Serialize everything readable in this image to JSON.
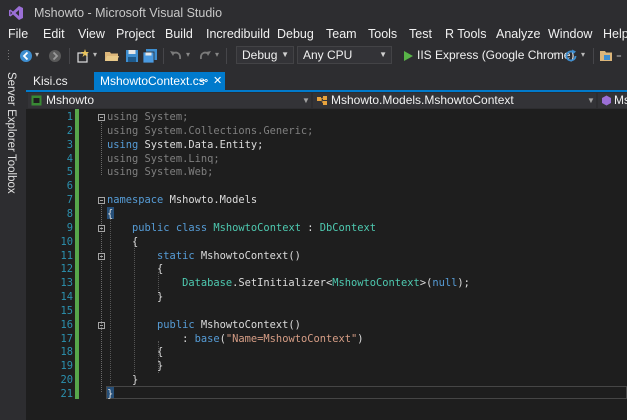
{
  "window": {
    "title": "Mshowto - Microsoft Visual Studio"
  },
  "menu": [
    "File",
    "Edit",
    "View",
    "Project",
    "Build",
    "Incredibuild",
    "Debug",
    "Team",
    "Tools",
    "Test",
    "R Tools",
    "Analyze",
    "Window",
    "Help"
  ],
  "toolbar": {
    "configuration": "Debug",
    "platform": "Any CPU",
    "run_target": "IIS Express (Google Chrome)"
  },
  "side_tabs": [
    "Server Explorer",
    "Toolbox"
  ],
  "tabs": [
    {
      "label": "Kisi.cs",
      "active": false
    },
    {
      "label": "MshowtoContext.cs",
      "active": true
    }
  ],
  "nav": {
    "project": "Mshowto",
    "class": "Mshowto.Models.MshowtoContext",
    "member": "Ms"
  },
  "line_numbers": [
    "1",
    "2",
    "3",
    "4",
    "5",
    "6",
    "7",
    "8",
    "9",
    "10",
    "11",
    "12",
    "13",
    "14",
    "15",
    "16",
    "17",
    "18",
    "19",
    "20",
    "21"
  ],
  "code": [
    [
      [
        "u",
        "using"
      ],
      [
        "u",
        " System;"
      ]
    ],
    [
      [
        "u",
        "using"
      ],
      [
        "u",
        " System.Collections.Generic;"
      ]
    ],
    [
      [
        "k",
        "using"
      ],
      [
        "p",
        " System.Data.Entity;"
      ]
    ],
    [
      [
        "u",
        "using"
      ],
      [
        "u",
        " System.Linq;"
      ]
    ],
    [
      [
        "u",
        "using"
      ],
      [
        "u",
        " System.Web;"
      ]
    ],
    [],
    [
      [
        "k",
        "namespace"
      ],
      [
        "p",
        " Mshowto.Models"
      ]
    ],
    [
      [
        "p",
        "{"
      ]
    ],
    [
      [
        "p",
        "    "
      ],
      [
        "k",
        "public"
      ],
      [
        "p",
        " "
      ],
      [
        "k",
        "class"
      ],
      [
        "p",
        " "
      ],
      [
        "t",
        "MshowtoContext"
      ],
      [
        "p",
        " : "
      ],
      [
        "t",
        "DbContext"
      ]
    ],
    [
      [
        "p",
        "    {"
      ]
    ],
    [
      [
        "p",
        "        "
      ],
      [
        "k",
        "static"
      ],
      [
        "p",
        " MshowtoContext()"
      ]
    ],
    [
      [
        "p",
        "        {"
      ]
    ],
    [
      [
        "p",
        "            "
      ],
      [
        "t",
        "Database"
      ],
      [
        "p",
        ".SetInitializer<"
      ],
      [
        "t",
        "MshowtoContext"
      ],
      [
        "p",
        ">("
      ],
      [
        "k",
        "null"
      ],
      [
        "p",
        ");"
      ]
    ],
    [
      [
        "p",
        "        }"
      ]
    ],
    [],
    [
      [
        "p",
        "        "
      ],
      [
        "k",
        "public"
      ],
      [
        "p",
        " MshowtoContext()"
      ]
    ],
    [
      [
        "p",
        "            : "
      ],
      [
        "k",
        "base"
      ],
      [
        "p",
        "("
      ],
      [
        "s",
        "\"Name=MshowtoContext\""
      ],
      [
        "p",
        ")"
      ]
    ],
    [
      [
        "p",
        "        {"
      ]
    ],
    [
      [
        "p",
        "        }"
      ]
    ],
    [
      [
        "p",
        "    }"
      ]
    ],
    [
      [
        "p",
        "}"
      ]
    ]
  ]
}
